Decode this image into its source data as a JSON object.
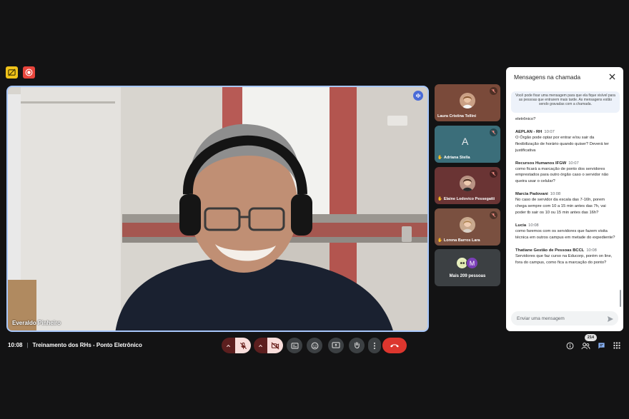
{
  "main": {
    "speaker_name": "Everaldo Pinheiro"
  },
  "tiles": [
    {
      "name": "Laura Cristina Tellini",
      "muted": true,
      "bg": "#7a4a3a"
    },
    {
      "name": "Adriana Stella",
      "avatar_letter": "A",
      "muted": true,
      "bg": "#3b6e7a"
    },
    {
      "name": "Elaine Lodovico Pessegatti",
      "muted": true,
      "bg": "#6a3434"
    },
    {
      "name": "Lorena Barros Lara",
      "muted": true,
      "bg": "#7a5040"
    }
  ],
  "more_tile": {
    "label": "Mais 209 pessoas",
    "avatar_letter": "M"
  },
  "chat": {
    "title": "Mensagens na chamada",
    "pin_info": "Você pode fixar uma mensagem para que ela fique visível para as pessoas que entrarem mais tarde. As mensagens estão sendo gravadas com a chamada.",
    "cut_message": "Qual será o perímetro para a marcação do ponto eletrônico?",
    "messages": [
      {
        "sender": "AEPLAN - RH",
        "time": "10:07",
        "text": "O Órgão pode optar por entrar e/ou sair da flexibilização de horário quando quiser? Deverá ter justificativa"
      },
      {
        "sender": "Recursos Humanos IFGW",
        "time": "10:07",
        "text": "como ficará a marcação de ponto dos servidores emprestados para outro órgão caso o servidor não queira usar o celular?"
      },
      {
        "sender": "Marcia Padovani",
        "time": "10:08",
        "text": "No caso de servidor da escala das 7-16h, porem chega sempre com 10 a 15 min antes das 7h, vai poder tb sair os 10 ou 15 min antes das 16h?"
      },
      {
        "sender": "Lucia",
        "time": "10:08",
        "text": "como faremos com os servidores que fazem visita técnica em outros campus  em metade do expediente?"
      },
      {
        "sender": "Thatiane Gestão de Pessoas BCCL",
        "time": "10:08",
        "text": "Servidores que faz curso na Educorp, porém on line, fora do campus, como fica a marcação do ponto?"
      }
    ],
    "input_placeholder": "Enviar uma mensagem"
  },
  "bottom": {
    "time": "10:08",
    "meeting_title": "Treinamento dos RHs - Ponto Eletrônico",
    "participant_count": "214"
  },
  "colors": {
    "accent": "#a8c7fa",
    "end_call": "#dc362e",
    "muted_bg": "#f9dedc",
    "muted_dark": "#5c1f1f",
    "chat_active": "#8ab4f8"
  }
}
